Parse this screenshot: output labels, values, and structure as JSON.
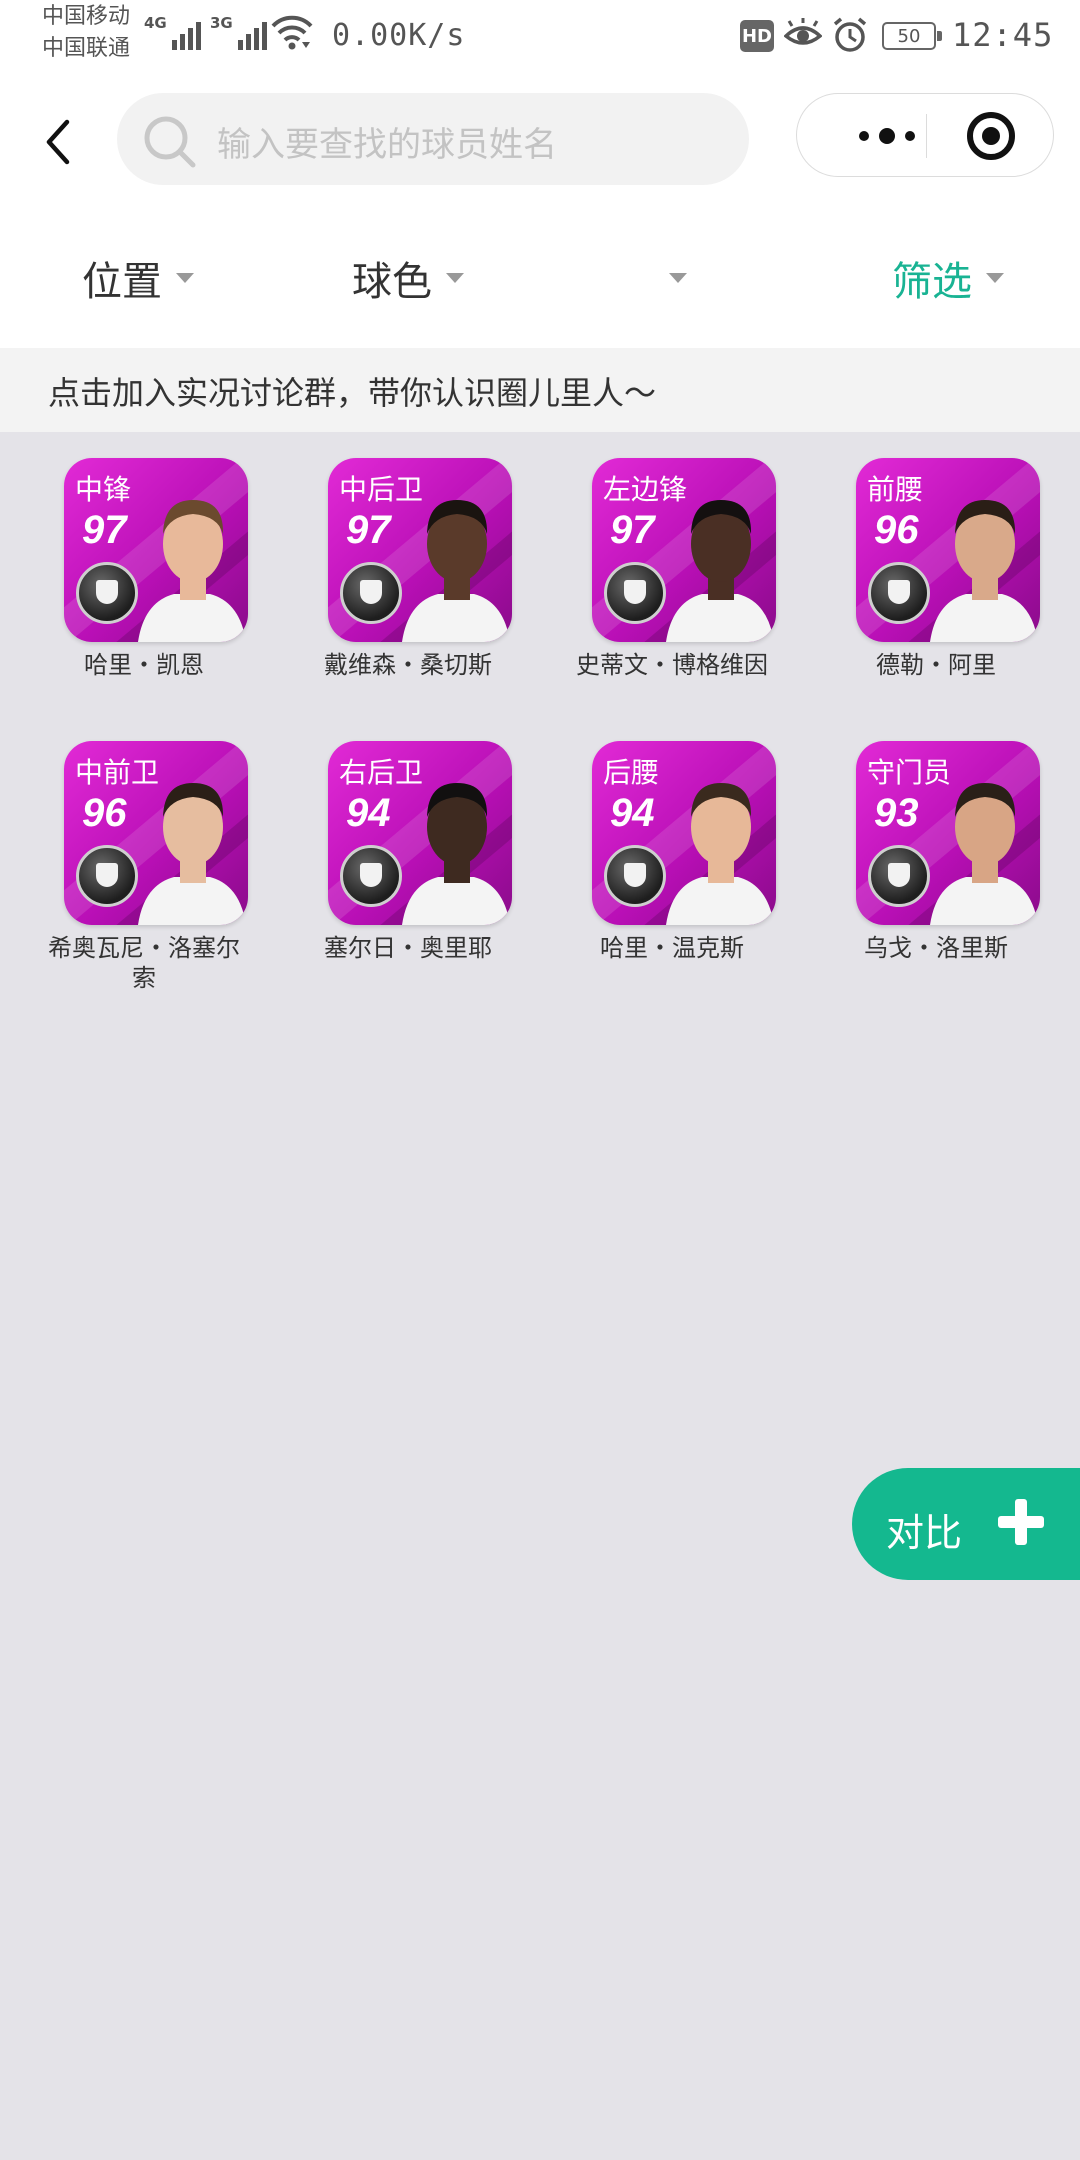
{
  "status_bar": {
    "carrier_1": "中国移动",
    "carrier_2": "中国联通",
    "net_tag_1": "4G",
    "net_tag_2": "3G",
    "speed": "0.00K/s",
    "hd": "HD",
    "battery": "50",
    "time": "12:45"
  },
  "search": {
    "placeholder": "输入要查找的球员姓名"
  },
  "filters": {
    "position": "位置",
    "color": "球色",
    "unnamed": "",
    "filter": "筛选",
    "active_color": "#19b393"
  },
  "notice": {
    "text": "点击加入实况讨论群，带你认识圈儿里人～"
  },
  "players": [
    {
      "position": "中锋",
      "rating": "97",
      "name": "哈里・凯恩"
    },
    {
      "position": "中后卫",
      "rating": "97",
      "name": "戴维森・桑切斯"
    },
    {
      "position": "左边锋",
      "rating": "97",
      "name": "史蒂文・博格维因"
    },
    {
      "position": "前腰",
      "rating": "96",
      "name": "德勒・阿里"
    },
    {
      "position": "中前卫",
      "rating": "96",
      "name": "希奥瓦尼・洛塞尔索"
    },
    {
      "position": "右后卫",
      "rating": "94",
      "name": "塞尔日・奥里耶"
    },
    {
      "position": "后腰",
      "rating": "94",
      "name": "哈里・温克斯"
    },
    {
      "position": "守门员",
      "rating": "93",
      "name": "乌戈・洛里斯"
    }
  ],
  "compare": {
    "label": "对比",
    "color": "#14b88f"
  },
  "icons": {
    "back": "chevron-left-icon",
    "search": "search-icon",
    "more": "more-dots-icon",
    "close": "target-circle-icon",
    "compare_add": "plus-icon",
    "card_badge": "team-crest-icon"
  }
}
